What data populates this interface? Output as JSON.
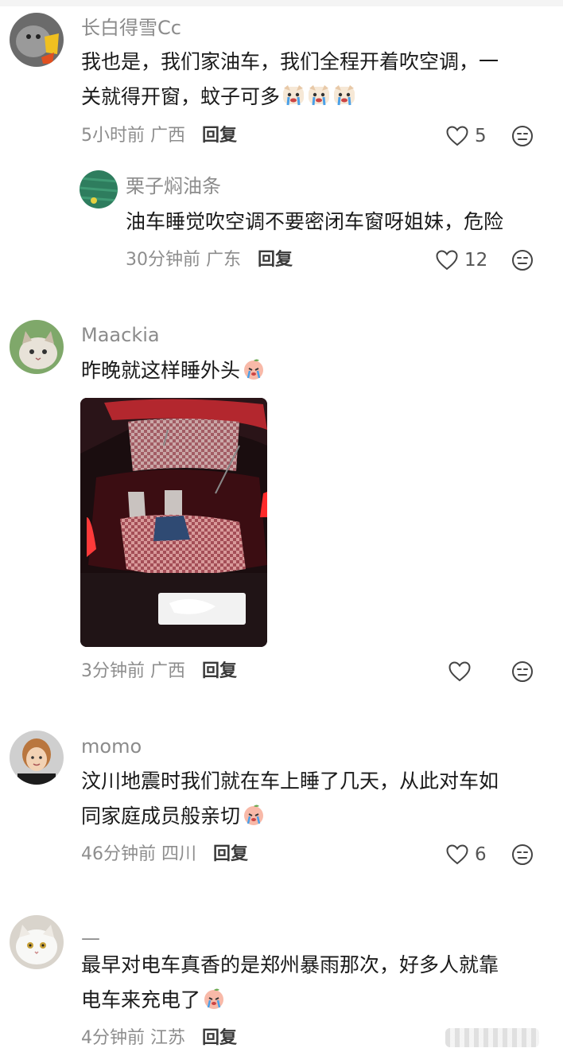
{
  "comments": [
    {
      "username": "长白得雪Cc",
      "text_line1": "我也是，我们家油车，我们全程开着吹空调，一",
      "text_line2": "关就得开窗，蚊子可多",
      "time": "5小时前",
      "location": "广西",
      "reply_label": "回复",
      "likes": "5",
      "emojis": [
        "crying-dog-emoji",
        "crying-dog-emoji",
        "crying-dog-emoji"
      ],
      "replies": [
        {
          "username": "栗子焖油条",
          "text": "油车睡觉吹空调不要密闭车窗呀姐妹，危险",
          "time": "30分钟前",
          "location": "广东",
          "reply_label": "回复",
          "likes": "12"
        }
      ]
    },
    {
      "username": "Maackia",
      "text_line1": "昨晚就这样睡外头",
      "time": "3分钟前",
      "location": "广西",
      "reply_label": "回复",
      "likes": "",
      "emojis": [
        "crying-peach-emoji"
      ]
    },
    {
      "username": "momo",
      "text_line1": "汶川地震时我们就在车上睡了几天，从此对车如",
      "text_line2": "同家庭成员般亲切",
      "time": "46分钟前",
      "location": "四川",
      "reply_label": "回复",
      "likes": "6",
      "emojis": [
        "crying-peach-emoji"
      ]
    },
    {
      "username": "—",
      "text_line1": "最早对电车真香的是郑州暴雨那次，好多人就靠",
      "text_line2": "电车来充电了",
      "time": "4分钟前",
      "location": "江苏",
      "reply_label": "回复",
      "emojis": [
        "crying-peach-emoji"
      ]
    }
  ],
  "colors": {
    "username": "#8b8b8b",
    "text": "#1a1a1a",
    "meta": "#8d8d8d",
    "reply": "#3a3a3a",
    "icon_stroke": "#444444"
  }
}
